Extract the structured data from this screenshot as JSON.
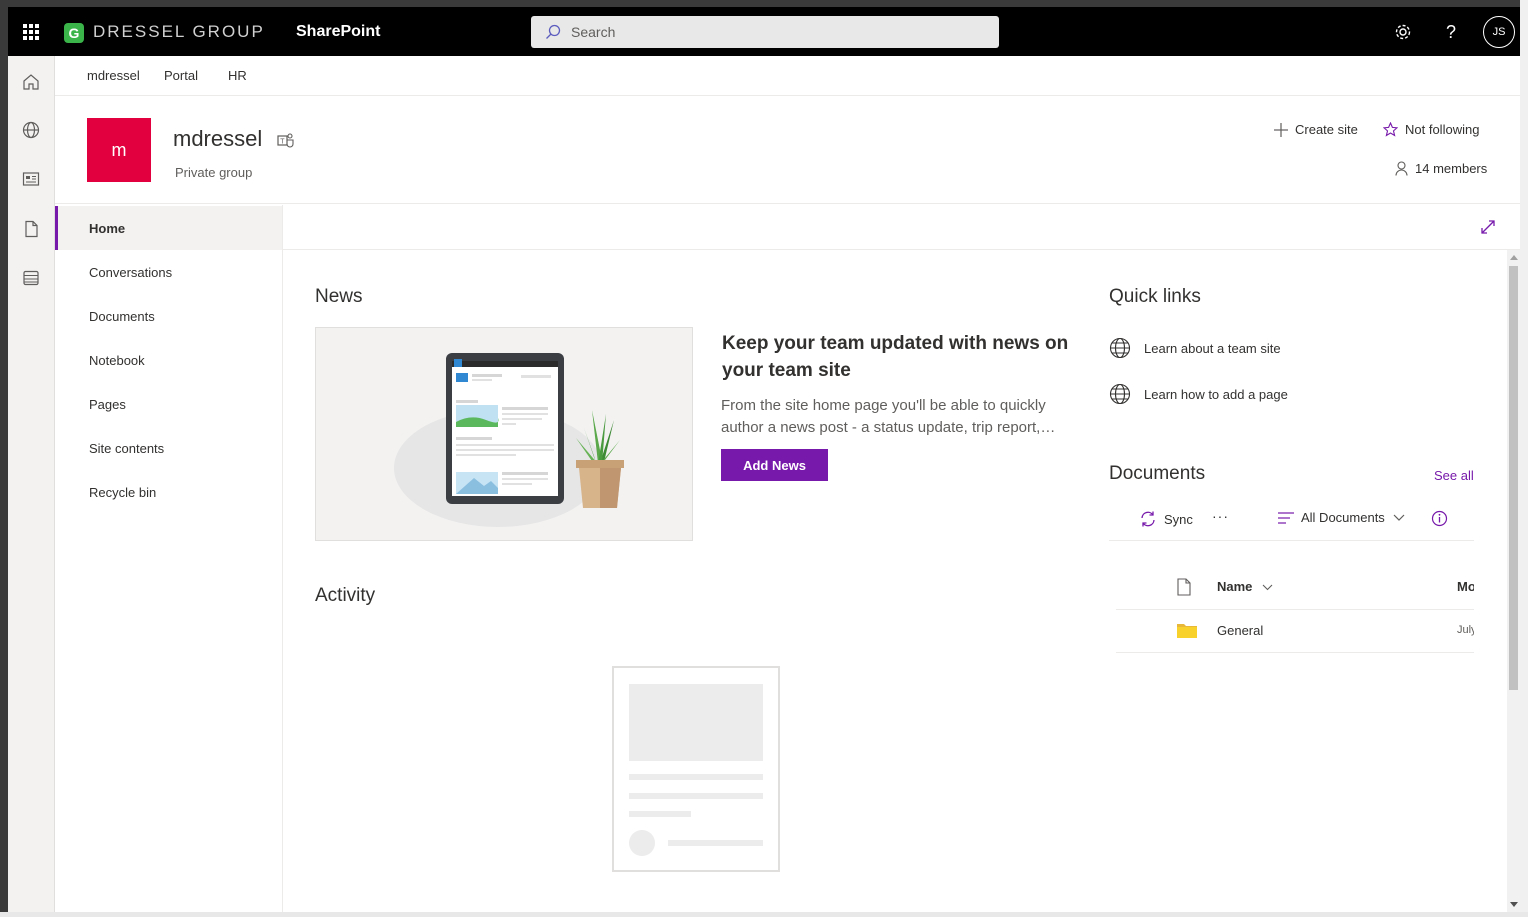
{
  "suite": {
    "brand_initial": "G",
    "brand_name": "DRESSEL GROUP",
    "app_name": "SharePoint",
    "search_placeholder": "Search",
    "user_initials": "JS"
  },
  "hub_nav": [
    "mdressel",
    "Portal",
    "HR"
  ],
  "site": {
    "logo_letter": "m",
    "title": "mdressel",
    "subtitle": "Private group",
    "create_site": "Create site",
    "follow": "Not following",
    "members": "14 members"
  },
  "left_nav": {
    "items": [
      {
        "label": "Home",
        "selected": true
      },
      {
        "label": "Conversations"
      },
      {
        "label": "Documents"
      },
      {
        "label": "Notebook"
      },
      {
        "label": "Pages"
      },
      {
        "label": "Site contents"
      },
      {
        "label": "Recycle bin"
      }
    ]
  },
  "news": {
    "title": "News",
    "headline": "Keep your team updated with news on your team site",
    "description": "From the site home page you'll be able to quickly author a news post - a status update, trip report,…",
    "button": "Add News"
  },
  "activity": {
    "title": "Activity"
  },
  "quick_links": {
    "title": "Quick links",
    "items": [
      "Learn about a team site",
      "Learn how to add a page"
    ]
  },
  "documents": {
    "title": "Documents",
    "see_all": "See all",
    "sync": "Sync",
    "more": "···",
    "view": "All Documents",
    "col_name": "Name",
    "col_modified": "Mo",
    "rows": [
      {
        "name": "General",
        "modified": "July"
      }
    ]
  },
  "colors": {
    "accent": "#7719aa",
    "site_logo": "#e3003f",
    "brand_green": "#3bb54a",
    "folder": "#f8d22a"
  }
}
